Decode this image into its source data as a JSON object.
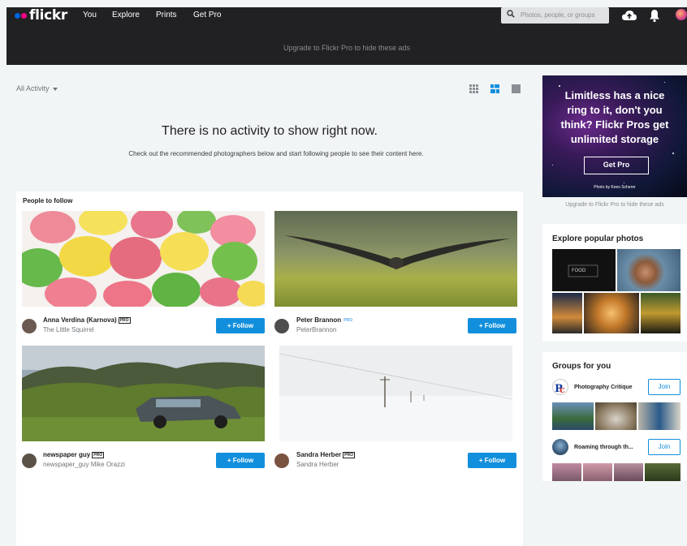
{
  "nav": {
    "logo_text": "flickr",
    "links": [
      "You",
      "Explore",
      "Prints",
      "Get Pro"
    ],
    "search_placeholder": "Photos, people, or groups",
    "upgrade_banner": "Upgrade to Flickr Pro to hide these ads",
    "icons": [
      "search-icon",
      "upload-cloud-icon",
      "bell-icon",
      "user-avatar"
    ]
  },
  "activity": {
    "filter_label": "All Activity",
    "view_icons": [
      "grid-view-icon",
      "medium-view-icon",
      "large-view-icon"
    ],
    "empty_title": "There is no activity to show right now.",
    "empty_subtitle": "Check out the recommended photographers below and start following people to see their content here."
  },
  "people_to_follow": {
    "title": "People to follow",
    "follow_label": "+ Follow",
    "pro_badge": "PRO",
    "people": [
      {
        "name": "Anna Verdina (Karnova)",
        "sub": "The Little Squirrel",
        "pro": true,
        "pro_style": "box"
      },
      {
        "name": "Peter Brannon",
        "sub": "PeterBrannon",
        "pro": true,
        "pro_style": "blue"
      },
      {
        "name": "newspaper guy",
        "sub": "newspaper_guy Mike Orazzi",
        "pro": true,
        "pro_style": "box"
      },
      {
        "name": "Sandra Herber",
        "sub": "Sandra Herber",
        "pro": true,
        "pro_style": "box"
      }
    ]
  },
  "ad": {
    "headline_lines": [
      "Limitless has a nice",
      "ring to it, don't you",
      "think? Flickr Pros get",
      "unlimited storage"
    ],
    "button_label": "Get Pro",
    "credit": "Photo by Kees Scherer",
    "upgrade_note": "Upgrade to Flickr Pro to hide these ads"
  },
  "explore": {
    "title": "Explore popular photos"
  },
  "groups": {
    "title": "Groups for you",
    "join_label": "Join",
    "items": [
      {
        "name": "Photography Critique"
      },
      {
        "name": "Roaming through th..."
      }
    ]
  },
  "colors": {
    "topbar": "#212124",
    "accent_blue": "#128fdc",
    "flickr_blue": "#0063dc",
    "flickr_pink": "#ff0084",
    "page_bg": "#f2f5f6"
  }
}
